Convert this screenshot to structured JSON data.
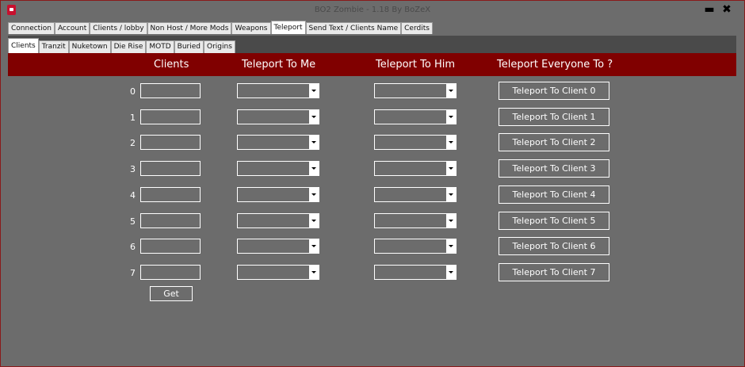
{
  "window": {
    "title": "BO2 Zombie - 1.18 By BoZeX",
    "minimize": "▬",
    "close": "✖"
  },
  "main_tabs": [
    "Connection",
    "Account",
    "Clients / lobby",
    "Non Host / More Mods",
    "Weapons",
    "Teleport",
    "Send Text  / Clients Name",
    "Cerdits"
  ],
  "main_active": "Teleport",
  "sub_tabs": [
    "Clients",
    "Tranzit",
    "Nuketown",
    "Die Rise",
    "MOTD",
    "Buried",
    "Origins"
  ],
  "sub_active": "Clients",
  "headers": {
    "clients": "Clients",
    "teleport_to_me": "Teleport To Me",
    "teleport_to_him": "Teleport To Him",
    "teleport_everyone": "Teleport Everyone To ?"
  },
  "rows": [
    {
      "num": "0",
      "button": "Teleport To Client 0"
    },
    {
      "num": "1",
      "button": "Teleport To Client 1"
    },
    {
      "num": "2",
      "button": "Teleport To Client 2"
    },
    {
      "num": "3",
      "button": "Teleport To Client 3"
    },
    {
      "num": "4",
      "button": "Teleport To Client 4"
    },
    {
      "num": "5",
      "button": "Teleport To Client 5"
    },
    {
      "num": "6",
      "button": "Teleport To Client 6"
    },
    {
      "num": "7",
      "button": "Teleport To Client 7"
    }
  ],
  "get_button": "Get"
}
